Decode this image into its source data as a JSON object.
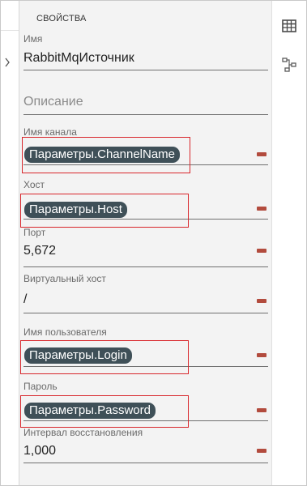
{
  "panel": {
    "section_title": "СВОЙСТВА"
  },
  "toolbar": {
    "items": [
      {
        "icon": "table-icon"
      },
      {
        "icon": "diagram-connect-icon"
      }
    ]
  },
  "fields": {
    "name": {
      "label": "Имя",
      "value": "RabbitMqИсточник"
    },
    "description": {
      "placeholder": "Описание"
    },
    "channel": {
      "label": "Имя канала",
      "value": "Параметры.ChannelName"
    },
    "host": {
      "label": "Хост",
      "value": "Параметры.Host"
    },
    "port": {
      "label": "Порт",
      "value": "5,672"
    },
    "vhost": {
      "label": "Виртуальный хост",
      "value": "/"
    },
    "username": {
      "label": "Имя пользователя",
      "value": "Параметры.Login"
    },
    "password": {
      "label": "Пароль",
      "value": "Параметры.Password"
    },
    "retry": {
      "label": "Интервал восстановления",
      "value": "1,000"
    }
  },
  "colors": {
    "pill_bg": "#3f5058",
    "highlight": "#d8262b",
    "delete_button": "#b24b3d",
    "panel_bg": "#f3f3f3"
  }
}
